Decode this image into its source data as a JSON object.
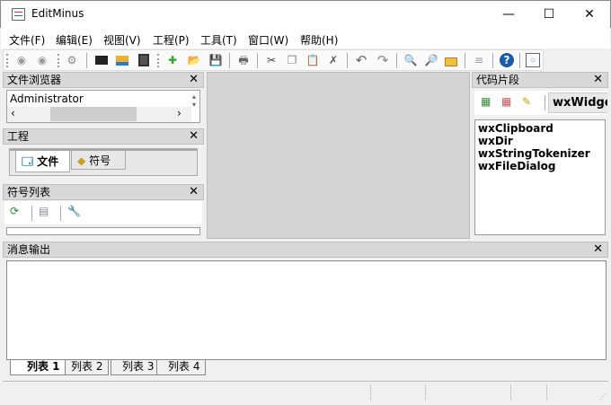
{
  "window": {
    "title": "EditMinus",
    "minimize": "—",
    "maximize": "☐",
    "close": "✕"
  },
  "menu": [
    "文件(F)",
    "编辑(E)",
    "视图(V)",
    "工程(P)",
    "工具(T)",
    "窗口(W)",
    "帮助(H)"
  ],
  "file_browser": {
    "title": "文件浏览器",
    "path": "Administrator"
  },
  "project": {
    "title": "工程",
    "tabs": [
      "文件",
      "符号"
    ]
  },
  "symbol_list": {
    "title": "符号列表"
  },
  "snippets": {
    "title": "代码片段",
    "category": "wxWidgets",
    "items": [
      "wxClipboard",
      "wxDir",
      "wxStringTokenizer",
      "wxFileDialog"
    ]
  },
  "output": {
    "title": "消息输出",
    "tabs": [
      "列表 1",
      "列表 2",
      "列表 3",
      "列表 4"
    ]
  },
  "close_glyph": "✕"
}
